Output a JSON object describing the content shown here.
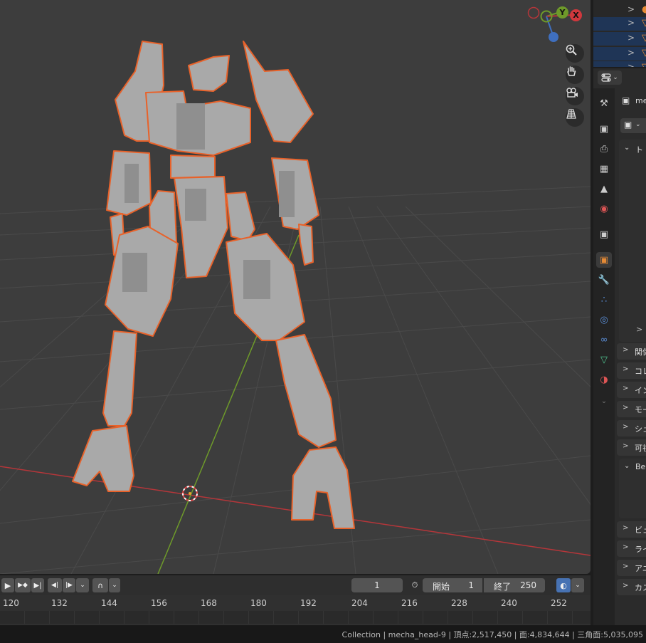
{
  "viewport": {
    "gizmo": {
      "y_label": "Y",
      "x_label": "X"
    },
    "nav_buttons": [
      "zoom-icon",
      "hand-pan-icon",
      "camera-icon",
      "grid-perspective-icon"
    ],
    "colors": {
      "background": "#3d3d3d",
      "x_axis": "#b5363a",
      "y_axis": "#6e9a2a",
      "selection_outline": "#e8622a",
      "mesh": "#a9a9a9"
    }
  },
  "outliner": {
    "rows": [
      {
        "chevron": ">",
        "icon": "object-data-icon"
      },
      {
        "chevron": ">",
        "icon": "mesh-triangle-icon"
      },
      {
        "chevron": ">",
        "icon": "mesh-triangle-icon"
      },
      {
        "chevron": ">",
        "icon": "mesh-triangle-icon"
      },
      {
        "chevron": ">",
        "icon": "mesh-triangle-icon"
      }
    ]
  },
  "properties": {
    "object_name": "me",
    "panels": [
      {
        "label": "ト",
        "expanded": true
      },
      {
        "label": "関係",
        "expanded": false
      },
      {
        "label": "コレ",
        "expanded": false
      },
      {
        "label": "イン",
        "expanded": false
      },
      {
        "label": "モー",
        "expanded": false
      },
      {
        "label": "シェ",
        "expanded": false
      },
      {
        "label": "可視",
        "expanded": false
      },
      {
        "label": "Bea",
        "expanded": true
      },
      {
        "label": "ビュ",
        "expanded": false
      },
      {
        "label": "ライ",
        "expanded": false
      },
      {
        "label": "アニ",
        "expanded": false
      },
      {
        "label": "カス",
        "expanded": false
      }
    ],
    "tabs": [
      "tool-icon",
      "render-icon",
      "output-icon",
      "view-layer-icon",
      "scene-icon",
      "world-icon",
      "collection-icon",
      "object-icon",
      "modifier-icon",
      "particles-icon",
      "physics-icon",
      "constraints-icon",
      "data-icon",
      "material-icon"
    ]
  },
  "timeline": {
    "current_frame": "1",
    "start_label": "開始",
    "start_value": "1",
    "end_label": "終了",
    "end_value": "250",
    "ruler_ticks": [
      "120",
      "132",
      "144",
      "156",
      "168",
      "180",
      "192",
      "204",
      "216",
      "228",
      "240",
      "252"
    ]
  },
  "statusbar": {
    "text": "Collection | mecha_head-9 | 頂点:2,517,450 | 面:4,834,644 | 三角面:5,035,095"
  }
}
